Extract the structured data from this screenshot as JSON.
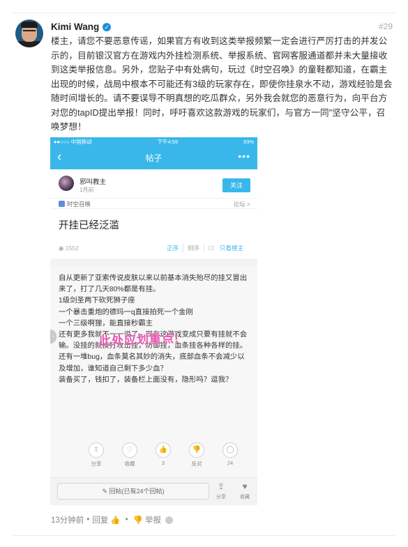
{
  "reply": {
    "author": "Kimi Wang",
    "floor": "#29",
    "text": "楼主，请您不要恶意传谣，如果官方有收到这类举报频繁一定会进行严厉打击的并发公示的，目前银汉官方在游戏内外挂检测系统、举报系统、官网客服通道都并未大量接收到这类举报信息。另外，您贴子中有处病句，玩过《时空召唤》的童鞋都知道，在霸主出现的时候，战局中根本不可能还有3级的玩家存在，即使你挂泉水不动，游戏经验是会随时间增长的。请不要误导不明真想的吃瓜群众，另外我会就您的恶意行为，向平台方对您的tapID提出举报！同时，呼吁喜欢这款游戏的玩家们，与官方一同\"坚守公平，召唤梦想！",
    "time": "13分钟前",
    "reply_label": "回复",
    "report_label": "举报"
  },
  "phone": {
    "carrier": "●●○○○ 中国移动 ",
    "clock": "下午4:59",
    "battery": "93%",
    "nav_title": "帖子",
    "poster_name": "邪叫教主",
    "poster_time": "1月前",
    "follow_label": "关注",
    "game_name": "时空召唤",
    "forum_link": "论坛 >",
    "post_title": "开挂已经泛滥",
    "views": "1552",
    "sort_options": [
      "正序",
      "倒序",
      "只看楼主"
    ],
    "watermark": "此处应划重点!",
    "body_lines": [
      "自从更新了亚索传说皮肤以来以前基本消失殆尽的挂又冒出来了，打了几天80%都是有挂。",
      "1级剑圣两下砍死狮子座",
      "一个暴击重炮的德玛一q直接拍死一个金刚",
      "一个三级啊狸，能直接秒霸主",
      "还有更多我就不一一说了，现在这游戏变成只要有挂就不会输。没挂的就挨打攻击挂，防御挂，血条挂各种各样的挂。",
      "还有一堆bug，血条莫名其妙的消失，底部血条不会减少以及增加，谁知道自己剩下多少血？",
      "装备买了，钱扣了，装备栏上面没有，隐形吗？逗我？"
    ],
    "actions": [
      {
        "icon": "share-icon",
        "label": "分享"
      },
      {
        "icon": "heart-icon",
        "label": "收藏"
      },
      {
        "icon": "thumbs-up-icon",
        "label": "3"
      },
      {
        "icon": "thumbs-down-icon",
        "label": "反对"
      },
      {
        "icon": "comment-icon",
        "label": "24"
      }
    ],
    "reply_box": "✎ 回帖(已有24个回帖)",
    "bottom_share": "分享",
    "bottom_fav": "收藏"
  }
}
